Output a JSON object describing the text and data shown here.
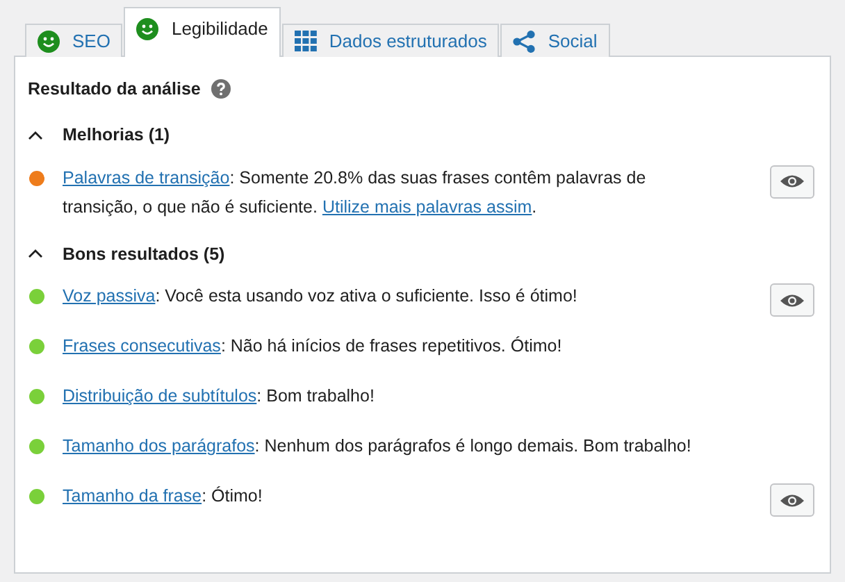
{
  "tabs": [
    {
      "label": "SEO",
      "kind": "smiley",
      "selected": false
    },
    {
      "label": "Legibilidade",
      "kind": "smiley",
      "selected": true
    },
    {
      "label": "Dados estruturados",
      "kind": "grid",
      "selected": false
    },
    {
      "label": "Social",
      "kind": "share",
      "selected": false
    }
  ],
  "panel": {
    "title": "Resultado da análise",
    "sections": [
      {
        "heading": "Melhorias (1)",
        "expanded": true,
        "results": [
          {
            "color": "#ee7c1b",
            "highlight": true,
            "parts": [
              {
                "kind": "link",
                "text": "Palavras de transição"
              },
              {
                "kind": "text",
                "text": ": Somente 20.8% das suas frases contêm palavras de transição, o que não é suficiente. "
              },
              {
                "kind": "link",
                "text": "Utilize mais palavras assim"
              },
              {
                "kind": "text",
                "text": "."
              }
            ]
          }
        ]
      },
      {
        "heading": "Bons resultados (5)",
        "expanded": true,
        "results": [
          {
            "color": "#7ad03a",
            "highlight": true,
            "parts": [
              {
                "kind": "link",
                "text": "Voz passiva"
              },
              {
                "kind": "text",
                "text": ": Você esta usando voz ativa o suficiente. Isso é ótimo!"
              }
            ]
          },
          {
            "color": "#7ad03a",
            "highlight": false,
            "parts": [
              {
                "kind": "link",
                "text": "Frases consecutivas"
              },
              {
                "kind": "text",
                "text": ": Não há inícios de frases repetitivos. Ótimo!"
              }
            ]
          },
          {
            "color": "#7ad03a",
            "highlight": false,
            "parts": [
              {
                "kind": "link",
                "text": "Distribuição de subtítulos"
              },
              {
                "kind": "text",
                "text": ": Bom trabalho!"
              }
            ]
          },
          {
            "color": "#7ad03a",
            "highlight": false,
            "parts": [
              {
                "kind": "link",
                "text": "Tamanho dos parágrafos"
              },
              {
                "kind": "text",
                "text": ": Nenhum dos parágrafos é longo demais. Bom trabalho!"
              }
            ]
          },
          {
            "color": "#7ad03a",
            "highlight": true,
            "parts": [
              {
                "kind": "link",
                "text": "Tamanho da frase"
              },
              {
                "kind": "text",
                "text": ": Ótimo!"
              }
            ]
          }
        ]
      }
    ]
  }
}
